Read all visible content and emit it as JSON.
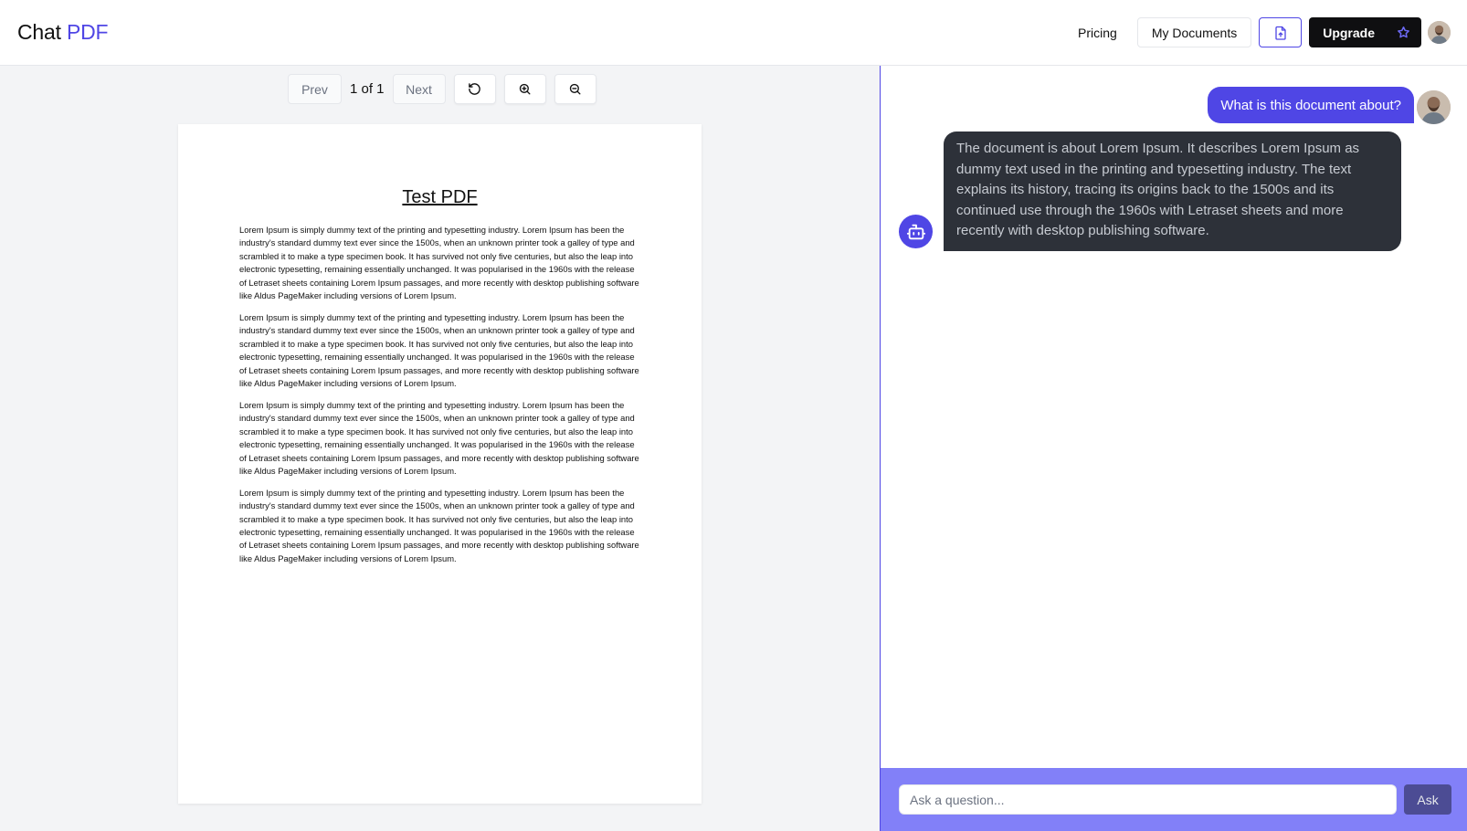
{
  "header": {
    "logo_part1": "Chat",
    "logo_part2": "PDF",
    "nav": {
      "pricing": "Pricing",
      "my_documents": "My Documents",
      "upload_icon": "file-upload-icon",
      "upgrade": "Upgrade",
      "upgrade_icon": "star-icon"
    }
  },
  "viewer": {
    "prev_label": "Prev",
    "page_indicator": "1 of 1",
    "next_label": "Next",
    "icons": [
      "rotate-icon",
      "zoom-in-icon",
      "zoom-out-icon"
    ],
    "document": {
      "title": "Test PDF",
      "paragraphs": [
        "Lorem Ipsum is simply dummy text of the printing and typesetting industry. Lorem Ipsum has been the industry's standard dummy text ever since the 1500s, when an unknown printer took a galley of type and scrambled it to make a type specimen book. It has survived not only five centuries, but also the leap into electronic typesetting, remaining essentially unchanged. It was popularised in the 1960s with the release of Letraset sheets containing Lorem Ipsum passages, and more recently with desktop publishing software like Aldus PageMaker including versions of Lorem Ipsum.",
        "Lorem Ipsum is simply dummy text of the printing and typesetting industry. Lorem Ipsum has been the industry's standard dummy text ever since the 1500s, when an unknown printer took a galley of type and scrambled it to make a type specimen book. It has survived not only five centuries, but also the leap into electronic typesetting, remaining essentially unchanged. It was popularised in the 1960s with the release of Letraset sheets containing Lorem Ipsum passages, and more recently with desktop publishing software like Aldus PageMaker including versions of Lorem Ipsum.",
        "Lorem Ipsum is simply dummy text of the printing and typesetting industry. Lorem Ipsum has been the industry's standard dummy text ever since the 1500s, when an unknown printer took a galley of type and scrambled it to make a type specimen book. It has survived not only five centuries, but also the leap into electronic typesetting, remaining essentially unchanged. It was popularised in the 1960s with the release of Letraset sheets containing Lorem Ipsum passages, and more recently with desktop publishing software like Aldus PageMaker including versions of Lorem Ipsum.",
        "Lorem Ipsum is simply dummy text of the printing and typesetting industry. Lorem Ipsum has been the industry's standard dummy text ever since the 1500s, when an unknown printer took a galley of type and scrambled it to make a type specimen book. It has survived not only five centuries, but also the leap into electronic typesetting, remaining essentially unchanged. It was popularised in the 1960s with the release of Letraset sheets containing Lorem Ipsum passages, and more recently with desktop publishing software like Aldus PageMaker including versions of Lorem Ipsum."
      ]
    }
  },
  "chat": {
    "messages": [
      {
        "role": "user",
        "text": "What is this document about?"
      },
      {
        "role": "assistant",
        "text": "The document is about Lorem Ipsum. It describes Lorem Ipsum as dummy text used in the printing and typesetting industry. The text explains its history, tracing its origins back to the 1500s and its continued use through the 1960s with Letraset sheets and more recently with desktop publishing software."
      }
    ],
    "input_placeholder": "Ask a question...",
    "input_value": "",
    "ask_label": "Ask",
    "bot_icon": "robot-icon"
  },
  "colors": {
    "accent": "#4f46e5",
    "ask_bar": "#8280f8",
    "bot_bubble": "#2d3139"
  }
}
